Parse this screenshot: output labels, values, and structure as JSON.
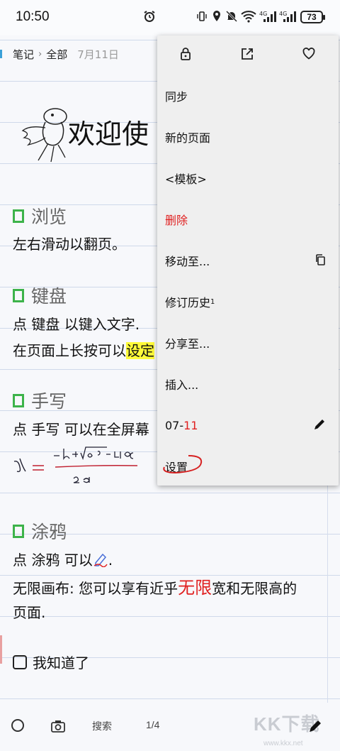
{
  "status_bar": {
    "time": "10:50",
    "battery": "73",
    "icons": [
      "alarm-icon",
      "vibrate-icon",
      "location-icon",
      "mute-icon",
      "wifi-icon",
      "signal-4g-icon",
      "signal-4g-icon"
    ]
  },
  "breadcrumb": {
    "notebook": "笔记",
    "separator": "›",
    "section": "全部",
    "date": "7月11日"
  },
  "page": {
    "welcome": "欢迎使",
    "sections": [
      {
        "title": "浏览",
        "lines": [
          "左右滑动以翻页。"
        ]
      },
      {
        "title": "键盘",
        "lines": [
          "点 键盘 以键入文字.",
          "在页面上长按可以"
        ],
        "highlight": "设定"
      },
      {
        "title": "手写",
        "lines": [
          "点 手写 可以在全屏幕"
        ]
      },
      {
        "title": "涂鸦",
        "lines": [
          "点 涂鸦 可以",
          "无限画布: 您可以享有近乎",
          "宽和无限高的",
          "页面."
        ],
        "emphasis": "无限"
      }
    ],
    "period": ".",
    "checkbox_label": "我知道了"
  },
  "menu": {
    "items": [
      {
        "label": "同步"
      },
      {
        "label": "新的页面"
      },
      {
        "label": "<模板>"
      },
      {
        "label": "删除"
      },
      {
        "label": "移动至..."
      },
      {
        "label": "修订历史",
        "sup": "1"
      },
      {
        "label": "分享至..."
      },
      {
        "label": "插入..."
      },
      {
        "label": "07-",
        "label_red": "11"
      },
      {
        "label": "设置"
      }
    ]
  },
  "bottom_bar": {
    "search": "搜索",
    "page_indicator": "1/4"
  },
  "watermark": {
    "text": "KK下载",
    "url": "www.kkx.net"
  },
  "colors": {
    "accent_green": "#3db34a",
    "delete_red": "#e02020",
    "highlight_yellow": "#fffb3a"
  }
}
